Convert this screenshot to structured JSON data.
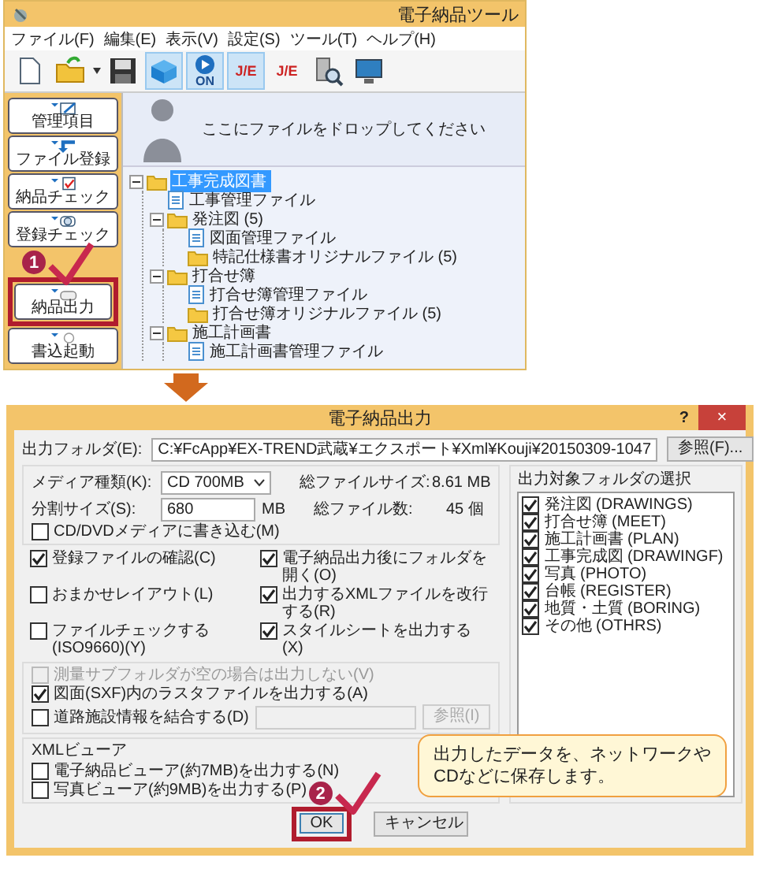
{
  "app": {
    "title": "電子納品ツール",
    "menu": [
      "ファイル(F)",
      "編集(E)",
      "表示(V)",
      "設定(S)",
      "ツール(T)",
      "ヘルプ(H)"
    ],
    "toolbar": [
      {
        "kind": "new",
        "toggled": false
      },
      {
        "kind": "open",
        "toggled": false
      },
      {
        "kind": "save",
        "toggled": false
      },
      {
        "kind": "box",
        "toggled": true
      },
      {
        "kind": "on",
        "label": "ON",
        "toggled": true
      },
      {
        "kind": "je",
        "label": "J/E",
        "toggled": true
      },
      {
        "kind": "je",
        "label": "J/E",
        "toggled": false
      },
      {
        "kind": "search",
        "toggled": false
      },
      {
        "kind": "monitor",
        "toggled": false
      }
    ],
    "sidebar": [
      {
        "kind": "manage",
        "label": "管理項目"
      },
      {
        "kind": "register",
        "label": "ファイル登録"
      },
      {
        "kind": "check",
        "label": "納品チェック"
      },
      {
        "kind": "regcheck",
        "label": "登録チェック"
      },
      {
        "kind": "export",
        "label": "納品出力",
        "step_badge": "1"
      },
      {
        "kind": "burn",
        "label": "書込起動"
      }
    ],
    "drop_hint": "ここにファイルをドロップしてください",
    "tree": [
      {
        "kind": "folder",
        "label": "工事完成図書",
        "selected": true,
        "expanded": true,
        "children": [
          {
            "kind": "file",
            "label": "工事管理ファイル",
            "selected": false
          },
          {
            "kind": "folder",
            "label": "発注図 (5)",
            "selected": false,
            "expanded": true,
            "children": [
              {
                "kind": "file",
                "label": "図面管理ファイル",
                "selected": false
              },
              {
                "kind": "folder",
                "label": "特記仕様書オリジナルファイル (5)",
                "selected": false
              }
            ]
          },
          {
            "kind": "folder",
            "label": "打合せ簿",
            "selected": false,
            "expanded": true,
            "children": [
              {
                "kind": "file",
                "label": "打合せ簿管理ファイル",
                "selected": false
              },
              {
                "kind": "folder",
                "label": "打合せ簿オリジナルファイル (5)",
                "selected": false
              }
            ]
          },
          {
            "kind": "folder",
            "label": "施工計画書",
            "selected": false,
            "expanded": true,
            "children": [
              {
                "kind": "file",
                "label": "施工計画書管理ファイル",
                "selected": false
              }
            ]
          }
        ]
      }
    ]
  },
  "dialog": {
    "title": "電子納品出力",
    "help": "?",
    "close": "×",
    "output_folder": {
      "label": "出力フォルダ(E):",
      "value": "C:¥FcApp¥EX-TREND武蔵¥エクスポート¥Xml¥Kouji¥20150309-1047",
      "button": "参照(F)..."
    },
    "media": {
      "label": "メディア種類(K):",
      "value": "CD  700MB"
    },
    "total_size": {
      "label": "総ファイルサイズ:",
      "value": "8.61 MB"
    },
    "split": {
      "label": "分割サイズ(S):",
      "value": "680",
      "unit": "MB"
    },
    "total_files": {
      "label": "総ファイル数:",
      "value": "45 個"
    },
    "burn": {
      "label": "CD/DVDメディアに書き込む(M)",
      "checked": false,
      "disabled": false
    },
    "options": [
      {
        "label": "登録ファイルの確認(C)",
        "checked": true,
        "disabled": false
      },
      {
        "label": "電子納品出力後にフォルダを開く(O)",
        "checked": true,
        "disabled": false
      },
      {
        "label": "おまかせレイアウト(L)",
        "checked": false,
        "disabled": false
      },
      {
        "label": "出力するXMLファイルを改行する(R)",
        "checked": true,
        "disabled": false
      },
      {
        "label": "ファイルチェックする(ISO9660)(Y)",
        "checked": false,
        "disabled": false
      },
      {
        "label": "スタイルシートを出力する(X)",
        "checked": true,
        "disabled": false
      }
    ],
    "sxf_options": [
      {
        "label": "測量サブフォルダが空の場合は出力しない(V)",
        "checked": false,
        "disabled": true
      },
      {
        "label": "図面(SXF)内のラスタファイルを出力する(A)",
        "checked": true,
        "disabled": false
      }
    ],
    "road": {
      "label": "道路施設情報を結合する(D)",
      "checked": false,
      "disabled": false,
      "button": "参照(I)",
      "button_disabled": true
    },
    "xml_viewer": {
      "title": "XMLビューア",
      "items": [
        {
          "label": "電子納品ビューア(約7MB)を出力する(N)",
          "checked": false,
          "disabled": false
        },
        {
          "label": "写真ビューア(約9MB)を出力する(P)",
          "checked": false,
          "disabled": false
        }
      ]
    },
    "folders": {
      "title": "出力対象フォルダの選択",
      "items": [
        {
          "label": "発注図 (DRAWINGS)",
          "checked": true,
          "disabled": false
        },
        {
          "label": "打合せ簿 (MEET)",
          "checked": true,
          "disabled": false
        },
        {
          "label": "施工計画書 (PLAN)",
          "checked": true,
          "disabled": false
        },
        {
          "label": "工事完成図 (DRAWINGF)",
          "checked": true,
          "disabled": false
        },
        {
          "label": "写真 (PHOTO)",
          "checked": true,
          "disabled": false
        },
        {
          "label": "台帳 (REGISTER)",
          "checked": true,
          "disabled": false
        },
        {
          "label": "地質・土質 (BORING)",
          "checked": true,
          "disabled": false
        },
        {
          "label": "その他 (OTHRS)",
          "checked": true,
          "disabled": false
        }
      ]
    },
    "buttons": [
      {
        "label": "OK",
        "default": true,
        "step_badge": "2"
      },
      {
        "label": "キャンセル",
        "default": false
      }
    ],
    "callout": [
      "出力したデータを、ネットワークや",
      "CDなどに保存します。"
    ]
  }
}
